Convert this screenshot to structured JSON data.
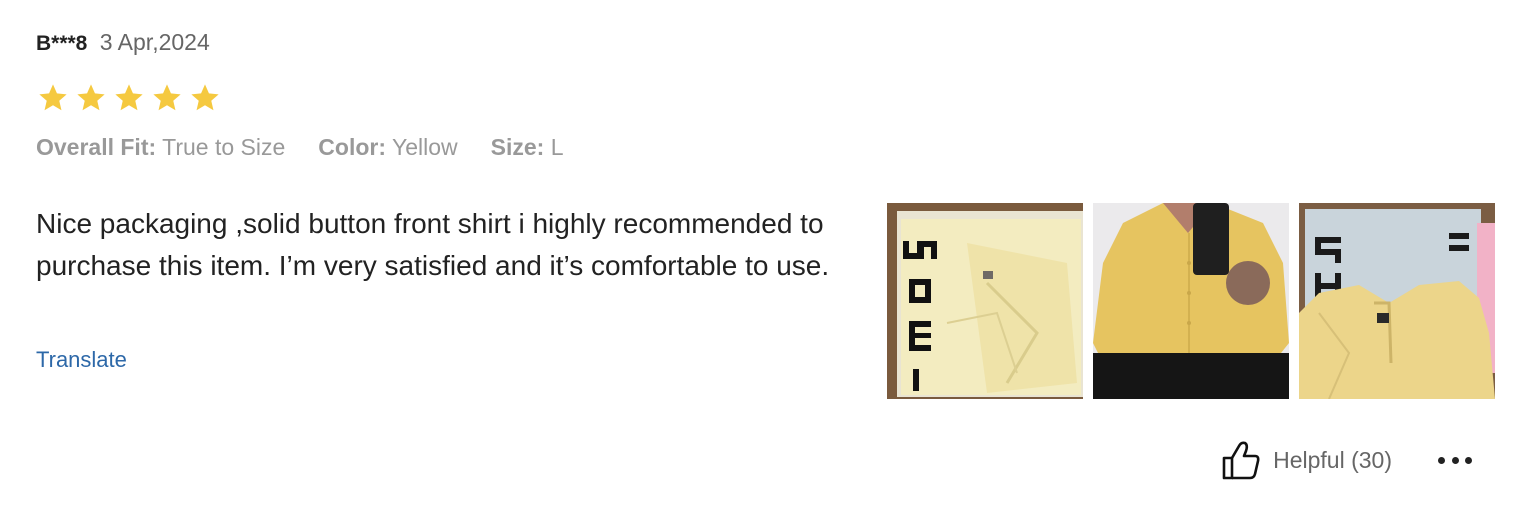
{
  "review": {
    "user": "B***8",
    "date": "3 Apr,2024",
    "rating": 5,
    "rating_max": 5,
    "star_color": "#f5c940",
    "attributes": [
      {
        "key": "Overall Fit:",
        "value": "True to Size"
      },
      {
        "key": "Color:",
        "value": "Yellow"
      },
      {
        "key": "Size:",
        "value": "L"
      }
    ],
    "content": "Nice packaging ,solid button front shirt i highly recommended to purchase this item. I’m very satisfied and it’s comfortable to use.",
    "translate_label": "Translate",
    "photo_count": 3,
    "helpful_label": "Helpful (30)",
    "link_color": "#2d68a8"
  },
  "icons": {
    "star": "star-icon",
    "helpful": "thumbs-up-icon",
    "more": "more-horizontal-icon"
  }
}
